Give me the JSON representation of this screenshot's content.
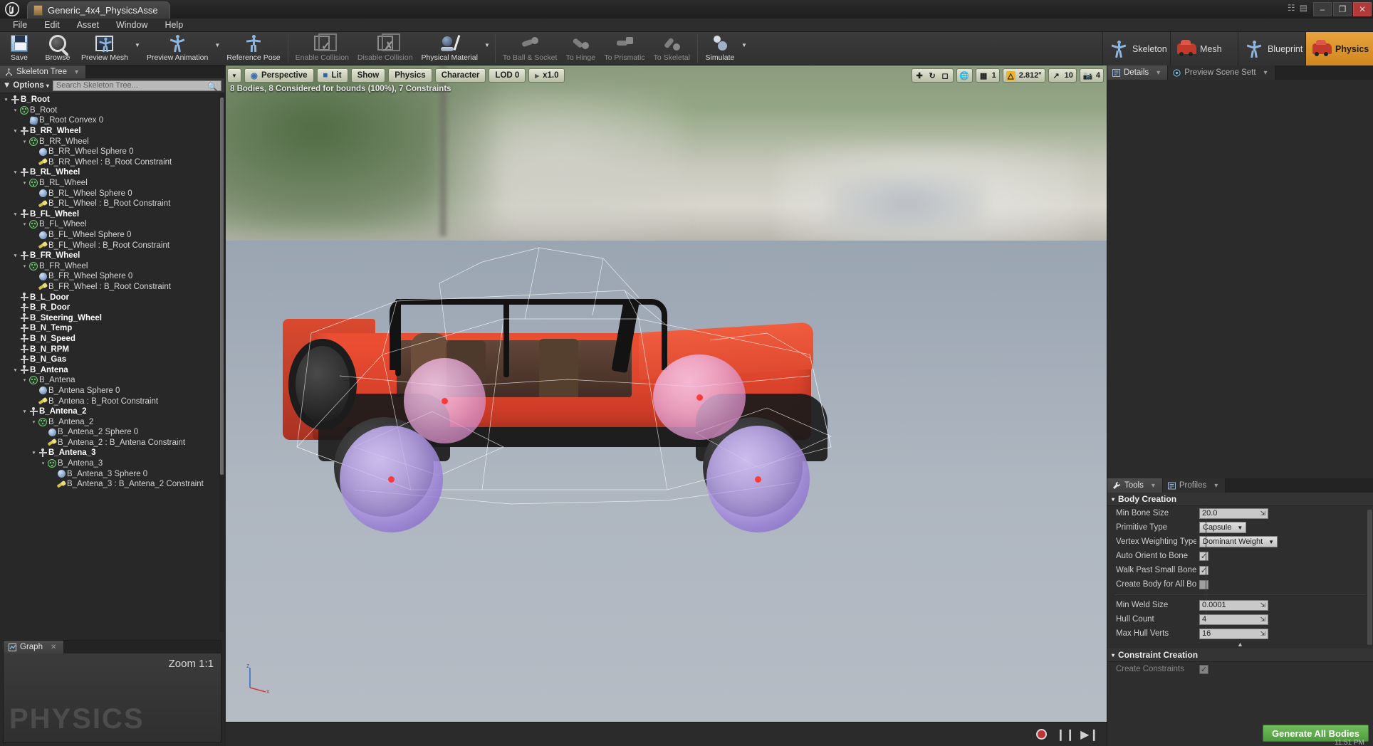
{
  "window": {
    "app_icon": "unreal-logo-icon",
    "tab_title": "Generic_4x4_PhysicsAsse",
    "minimize": "–",
    "maximize": "❐",
    "close": "✕"
  },
  "menubar": {
    "items": [
      "File",
      "Edit",
      "Asset",
      "Window",
      "Help"
    ]
  },
  "toolbar": {
    "groups": [
      {
        "items": [
          {
            "label": "Save",
            "icon": "save-icon",
            "dim": false,
            "arrow": false
          },
          {
            "label": "Browse",
            "icon": "browse-icon",
            "dim": false,
            "arrow": false
          },
          {
            "label": "Preview Mesh",
            "icon": "preview-mesh-icon",
            "dim": false,
            "arrow": true
          },
          {
            "label": "Preview Animation",
            "icon": "preview-animation-icon",
            "dim": false,
            "arrow": true
          },
          {
            "label": "Reference Pose",
            "icon": "reference-pose-icon",
            "dim": false,
            "arrow": false
          }
        ]
      },
      {
        "items": [
          {
            "label": "Enable Collision",
            "icon": "enable-collision-icon",
            "dim": true,
            "arrow": false
          },
          {
            "label": "Disable Collision",
            "icon": "disable-collision-icon",
            "dim": true,
            "arrow": false
          },
          {
            "label": "Physical Material",
            "icon": "physical-material-icon",
            "dim": false,
            "arrow": true
          }
        ]
      },
      {
        "items": [
          {
            "label": "To Ball & Socket",
            "icon": "to-ball-socket-icon",
            "dim": true,
            "arrow": false
          },
          {
            "label": "To Hinge",
            "icon": "to-hinge-icon",
            "dim": true,
            "arrow": false
          },
          {
            "label": "To Prismatic",
            "icon": "to-prismatic-icon",
            "dim": true,
            "arrow": false
          },
          {
            "label": "To Skeletal",
            "icon": "to-skeletal-icon",
            "dim": true,
            "arrow": false
          }
        ]
      },
      {
        "items": [
          {
            "label": "Simulate",
            "icon": "simulate-icon",
            "dim": false,
            "arrow": true
          }
        ]
      }
    ]
  },
  "mode_tabs": [
    {
      "label": "Skeleton",
      "icon": "skeleton-mode-icon",
      "active": false
    },
    {
      "label": "Mesh",
      "icon": "mesh-mode-icon",
      "active": false
    },
    {
      "label": "Blueprint",
      "icon": "blueprint-mode-icon",
      "active": false
    },
    {
      "label": "Physics",
      "icon": "physics-mode-icon",
      "active": true
    }
  ],
  "skeleton_tree": {
    "tab_label": "Skeleton Tree",
    "options_label": "Options",
    "search_placeholder": "Search Skeleton Tree...",
    "rows": [
      {
        "indent": 0,
        "twist": "▾",
        "icon": "bone",
        "label": "B_Root",
        "bold": true
      },
      {
        "indent": 1,
        "twist": "▾",
        "icon": "body",
        "label": "B_Root",
        "bold": false
      },
      {
        "indent": 2,
        "twist": "",
        "icon": "convex",
        "label": "B_Root Convex 0",
        "bold": false
      },
      {
        "indent": 1,
        "twist": "▾",
        "icon": "bone",
        "label": "B_RR_Wheel",
        "bold": true
      },
      {
        "indent": 2,
        "twist": "▾",
        "icon": "body",
        "label": "B_RR_Wheel",
        "bold": false
      },
      {
        "indent": 3,
        "twist": "",
        "icon": "sphere",
        "label": "B_RR_Wheel Sphere 0",
        "bold": false
      },
      {
        "indent": 3,
        "twist": "",
        "icon": "constraint",
        "label": "B_RR_Wheel : B_Root Constraint",
        "bold": false
      },
      {
        "indent": 1,
        "twist": "▾",
        "icon": "bone",
        "label": "B_RL_Wheel",
        "bold": true
      },
      {
        "indent": 2,
        "twist": "▾",
        "icon": "body",
        "label": "B_RL_Wheel",
        "bold": false
      },
      {
        "indent": 3,
        "twist": "",
        "icon": "sphere",
        "label": "B_RL_Wheel Sphere 0",
        "bold": false
      },
      {
        "indent": 3,
        "twist": "",
        "icon": "constraint",
        "label": "B_RL_Wheel : B_Root Constraint",
        "bold": false
      },
      {
        "indent": 1,
        "twist": "▾",
        "icon": "bone",
        "label": "B_FL_Wheel",
        "bold": true
      },
      {
        "indent": 2,
        "twist": "▾",
        "icon": "body",
        "label": "B_FL_Wheel",
        "bold": false
      },
      {
        "indent": 3,
        "twist": "",
        "icon": "sphere",
        "label": "B_FL_Wheel Sphere 0",
        "bold": false
      },
      {
        "indent": 3,
        "twist": "",
        "icon": "constraint",
        "label": "B_FL_Wheel : B_Root Constraint",
        "bold": false
      },
      {
        "indent": 1,
        "twist": "▾",
        "icon": "bone",
        "label": "B_FR_Wheel",
        "bold": true
      },
      {
        "indent": 2,
        "twist": "▾",
        "icon": "body",
        "label": "B_FR_Wheel",
        "bold": false
      },
      {
        "indent": 3,
        "twist": "",
        "icon": "sphere",
        "label": "B_FR_Wheel Sphere 0",
        "bold": false
      },
      {
        "indent": 3,
        "twist": "",
        "icon": "constraint",
        "label": "B_FR_Wheel : B_Root Constraint",
        "bold": false
      },
      {
        "indent": 1,
        "twist": "",
        "icon": "bone",
        "label": "B_L_Door",
        "bold": true
      },
      {
        "indent": 1,
        "twist": "",
        "icon": "bone",
        "label": "B_R_Door",
        "bold": true
      },
      {
        "indent": 1,
        "twist": "",
        "icon": "bone",
        "label": "B_Steering_Wheel",
        "bold": true
      },
      {
        "indent": 1,
        "twist": "",
        "icon": "bone",
        "label": "B_N_Temp",
        "bold": true
      },
      {
        "indent": 1,
        "twist": "",
        "icon": "bone",
        "label": "B_N_Speed",
        "bold": true
      },
      {
        "indent": 1,
        "twist": "",
        "icon": "bone",
        "label": "B_N_RPM",
        "bold": true
      },
      {
        "indent": 1,
        "twist": "",
        "icon": "bone",
        "label": "B_N_Gas",
        "bold": true
      },
      {
        "indent": 1,
        "twist": "▾",
        "icon": "bone",
        "label": "B_Antena",
        "bold": true
      },
      {
        "indent": 2,
        "twist": "▾",
        "icon": "body",
        "label": "B_Antena",
        "bold": false
      },
      {
        "indent": 3,
        "twist": "",
        "icon": "sphere",
        "label": "B_Antena Sphere 0",
        "bold": false
      },
      {
        "indent": 3,
        "twist": "",
        "icon": "constraint",
        "label": "B_Antena : B_Root Constraint",
        "bold": false
      },
      {
        "indent": 2,
        "twist": "▾",
        "icon": "bone",
        "label": "B_Antena_2",
        "bold": true
      },
      {
        "indent": 3,
        "twist": "▾",
        "icon": "body",
        "label": "B_Antena_2",
        "bold": false
      },
      {
        "indent": 4,
        "twist": "",
        "icon": "sphere",
        "label": "B_Antena_2 Sphere 0",
        "bold": false
      },
      {
        "indent": 4,
        "twist": "",
        "icon": "constraint",
        "label": "B_Antena_2 : B_Antena Constraint",
        "bold": false
      },
      {
        "indent": 3,
        "twist": "▾",
        "icon": "bone",
        "label": "B_Antena_3",
        "bold": true
      },
      {
        "indent": 4,
        "twist": "▾",
        "icon": "body",
        "label": "B_Antena_3",
        "bold": false
      },
      {
        "indent": 5,
        "twist": "",
        "icon": "sphere",
        "label": "B_Antena_3 Sphere 0",
        "bold": false
      },
      {
        "indent": 5,
        "twist": "",
        "icon": "constraint",
        "label": "B_Antena_3 : B_Antena_2 Constraint",
        "bold": false
      }
    ]
  },
  "graph_panel": {
    "tab_label": "Graph",
    "zoom_label": "Zoom 1:1",
    "watermark": "PHYSICS"
  },
  "viewport": {
    "buttons": [
      {
        "label": "Perspective",
        "icon": "camera-icon"
      },
      {
        "label": "Lit",
        "icon": "lighting-icon"
      },
      {
        "label": "Show",
        "icon": ""
      },
      {
        "label": "Physics",
        "icon": ""
      },
      {
        "label": "Character",
        "icon": ""
      },
      {
        "label": "LOD 0",
        "icon": ""
      },
      {
        "label": "x1.0",
        "icon": "playrate-icon"
      }
    ],
    "status_text": "8 Bodies, 8 Considered for bounds (100%), 7 Constraints",
    "right_controls": {
      "transform_icons": [
        "move-icon",
        "rotate-icon",
        "scale-icon"
      ],
      "coord_icon": "world-coords-icon",
      "grid_snap_icon": "grid-snap-icon",
      "grid_snap_value": "1",
      "angle_snap_icon": "angle-snap-icon",
      "angle_snap_value": "2.812°",
      "scale_snap_icon": "scale-snap-icon",
      "scale_snap_value": "10",
      "camera_speed_icon": "camera-speed-icon",
      "camera_speed_value": "4"
    },
    "axis_labels": {
      "up": "z",
      "right": "x"
    },
    "playbar": {
      "record_icon": "record-icon",
      "pause_icon": "pause-icon",
      "step_icon": "step-forward-icon"
    }
  },
  "details_panel": {
    "tabs": [
      {
        "label": "Details",
        "icon": "details-icon",
        "active": true
      },
      {
        "label": "Preview Scene Sett",
        "icon": "preview-scene-icon",
        "active": false
      }
    ]
  },
  "tools_panel": {
    "tabs": [
      {
        "label": "Tools",
        "icon": "wrench-icon",
        "active": true
      },
      {
        "label": "Profiles",
        "icon": "profiles-icon",
        "active": false
      }
    ],
    "sections": [
      {
        "title": "Body Creation",
        "rows": [
          {
            "name": "Min Bone Size",
            "type": "number",
            "value": "20.0"
          },
          {
            "name": "Primitive Type",
            "type": "combo",
            "value": "Capsule"
          },
          {
            "name": "Vertex Weighting Type",
            "type": "combo",
            "value": "Dominant Weight"
          },
          {
            "name": "Auto Orient to Bone",
            "type": "checkbox",
            "value": true
          },
          {
            "name": "Walk Past Small Bone",
            "type": "checkbox",
            "value": true
          },
          {
            "name": "Create Body for All Bo",
            "type": "checkbox",
            "value": false
          },
          {
            "name": "Min Weld Size",
            "type": "number",
            "value": "0.0001"
          },
          {
            "name": "Hull Count",
            "type": "number",
            "value": "4"
          },
          {
            "name": "Max Hull Verts",
            "type": "number",
            "value": "16"
          }
        ]
      },
      {
        "title": "Constraint Creation",
        "rows": [
          {
            "name": "Create Constraints",
            "type": "checkbox",
            "value": true
          }
        ]
      }
    ],
    "generate_button": "Generate All Bodies"
  },
  "statusbar": {
    "clock": "11:51 PM"
  },
  "colors": {
    "accent_orange": "#d8891f",
    "generate_green": "#4e9c3e",
    "panel_bg": "#2a2a2a",
    "toolbar_bg": "#363636",
    "viewport_sky": "#b9bcb0",
    "viewport_ground": "#a9b2bd",
    "vehicle_red": "#e04b30",
    "body_purple": "#a886e2",
    "body_pink": "#e296d2",
    "pivot_red": "#ff3a3a"
  }
}
